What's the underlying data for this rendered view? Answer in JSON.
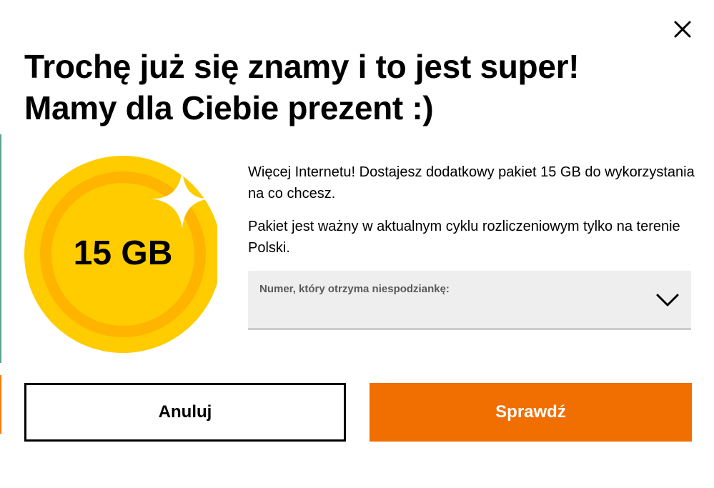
{
  "modal": {
    "title_line1": "Trochę już się znamy i to jest super!",
    "title_line2": "Mamy dla Ciebie prezent :)",
    "close_icon": "close-icon"
  },
  "offer": {
    "coin_label": "15 GB",
    "coin_icon": "sparkle-icon",
    "paragraph1": "Więcej Internetu! Dostajesz dodatkowy pakiet 15 GB do wykorzystania na co chcesz.",
    "paragraph2": "Pakiet jest ważny w aktualnym cyklu rozliczeniowym tylko na terenie Polski."
  },
  "number_select": {
    "label": "Numer, który otrzyma niespodziankę:",
    "value": "",
    "icon": "chevron-down-icon"
  },
  "buttons": {
    "cancel_label": "Anuluj",
    "confirm_label": "Sprawdź"
  },
  "colors": {
    "accent_orange": "#f16e00",
    "coin_yellow": "#ffcc00",
    "coin_ring": "#ffb400",
    "select_bg": "#eeeeee"
  }
}
